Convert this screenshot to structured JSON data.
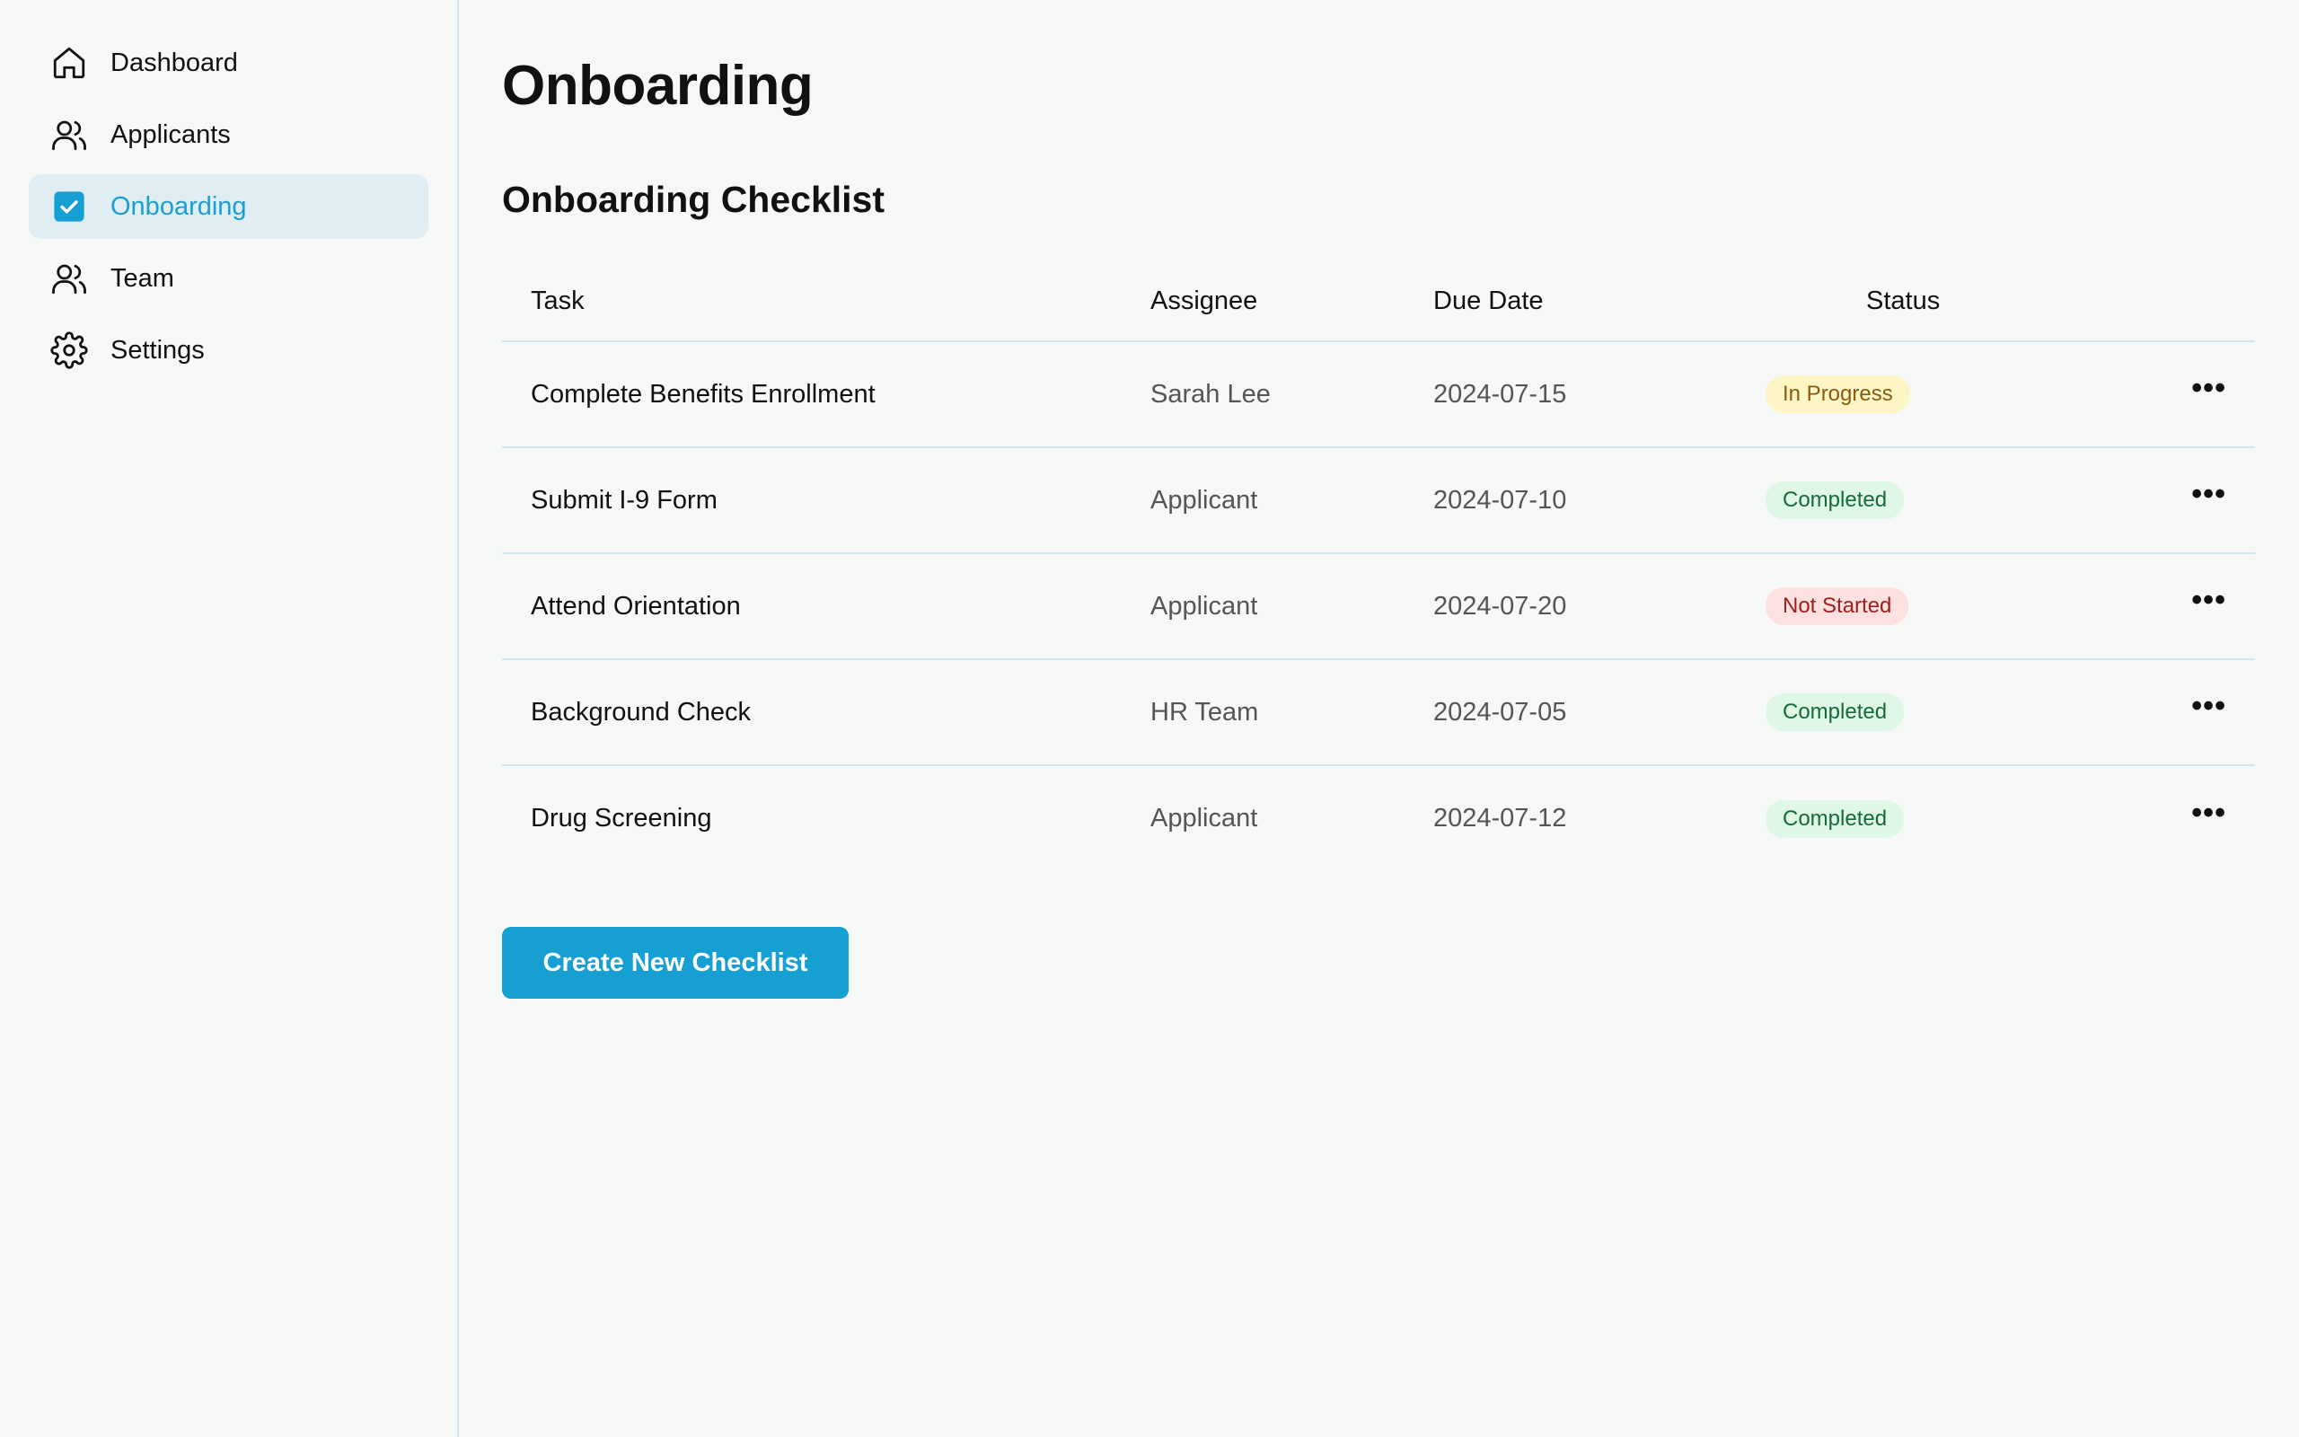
{
  "sidebar": {
    "items": [
      {
        "label": "Dashboard",
        "icon": "home-icon",
        "active": false
      },
      {
        "label": "Applicants",
        "icon": "users-icon",
        "active": false
      },
      {
        "label": "Onboarding",
        "icon": "check-square-icon",
        "active": true
      },
      {
        "label": "Team",
        "icon": "users-icon",
        "active": false
      },
      {
        "label": "Settings",
        "icon": "gear-icon",
        "active": false
      }
    ]
  },
  "main": {
    "title": "Onboarding",
    "section_title": "Onboarding Checklist",
    "table": {
      "headers": {
        "task": "Task",
        "assignee": "Assignee",
        "due_date": "Due Date",
        "status": "Status"
      },
      "rows": [
        {
          "task": "Complete Benefits Enrollment",
          "assignee": "Sarah Lee",
          "due_date": "2024-07-15",
          "status": "In Progress"
        },
        {
          "task": "Submit I-9 Form",
          "assignee": "Applicant",
          "due_date": "2024-07-10",
          "status": "Completed"
        },
        {
          "task": "Attend Orientation",
          "assignee": "Applicant",
          "due_date": "2024-07-20",
          "status": "Not Started"
        },
        {
          "task": "Background Check",
          "assignee": "HR Team",
          "due_date": "2024-07-05",
          "status": "Completed"
        },
        {
          "task": "Drug Screening",
          "assignee": "Applicant",
          "due_date": "2024-07-12",
          "status": "Completed"
        }
      ],
      "more_label": "•••"
    },
    "create_button_label": "Create New Checklist"
  },
  "colors": {
    "accent": "#169fd3",
    "active_nav_bg": "#e0eef4",
    "in_progress_bg": "#fdf6c4",
    "completed_bg": "#dff7e7",
    "not_started_bg": "#fde0e0"
  }
}
